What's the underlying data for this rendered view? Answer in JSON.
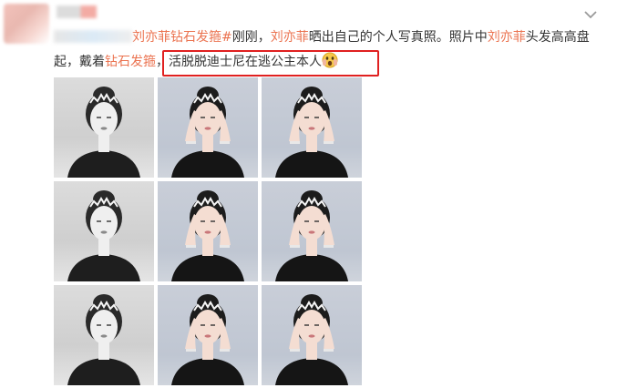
{
  "post": {
    "pre": "",
    "hashtag": "刘亦菲钻石发箍#",
    "t1": "刚刚，",
    "name1": "刘亦菲",
    "t2": "晒出自己的个人写真照。照片中",
    "name2": "刘亦菲",
    "t3": "头发高高盘起，戴着",
    "keyword": "钻石发箍",
    "t4": "，",
    "highlight": "活脱脱迪士尼在逃公主本人",
    "emoji": "shocked-emoji"
  },
  "icons": {
    "menu": "chevron-down-icon"
  },
  "colors": {
    "link": "#eb7350",
    "highlight_border": "#e02020"
  },
  "photos": [
    {
      "style": "bw"
    },
    {
      "style": "color"
    },
    {
      "style": "color"
    },
    {
      "style": "bw"
    },
    {
      "style": "color"
    },
    {
      "style": "color"
    },
    {
      "style": "bw"
    },
    {
      "style": "color"
    },
    {
      "style": "color"
    }
  ]
}
